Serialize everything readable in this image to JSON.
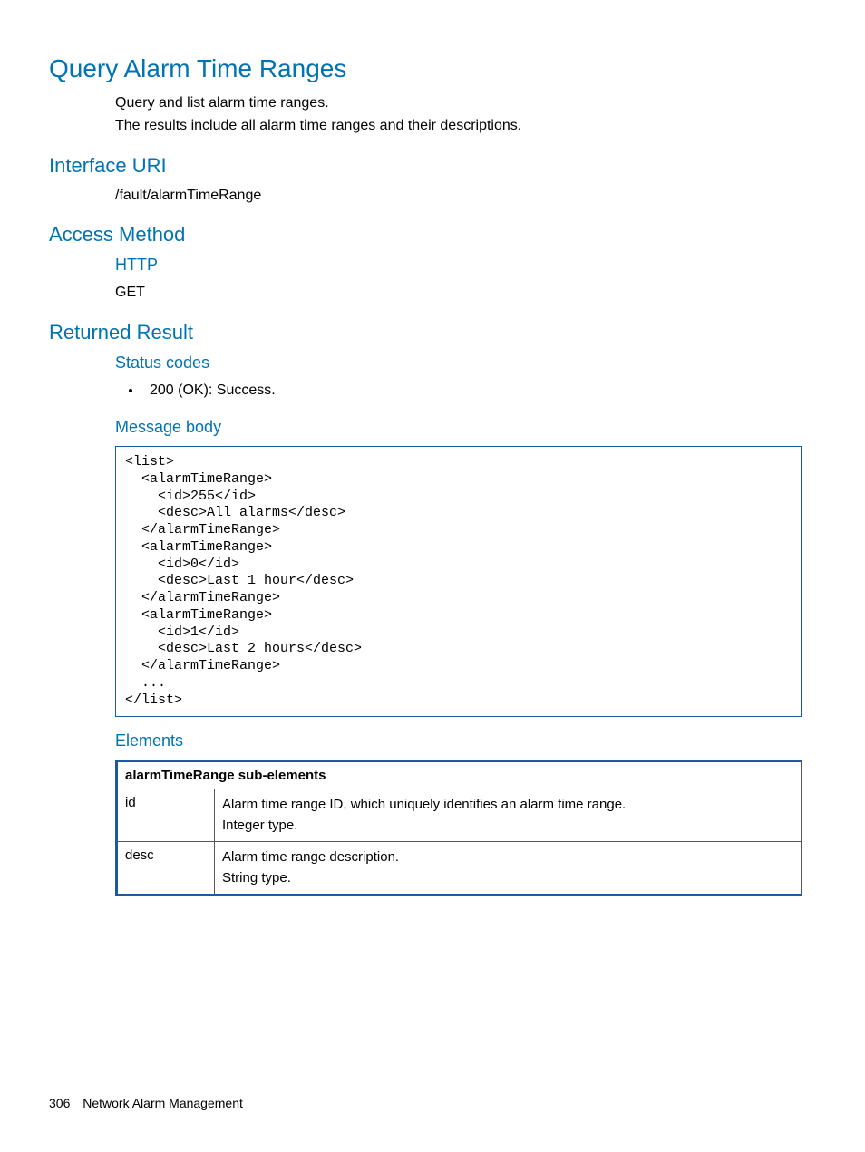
{
  "page": {
    "title": "Query Alarm Time Ranges",
    "intro1": "Query and list alarm time ranges.",
    "intro2": "The results include all alarm time ranges and their descriptions."
  },
  "interface_uri": {
    "heading": "Interface URI",
    "value": "/fault/alarmTimeRange"
  },
  "access_method": {
    "heading": "Access Method",
    "http_label": "HTTP",
    "http_method": "GET"
  },
  "returned_result": {
    "heading": "Returned Result",
    "status_codes_heading": "Status codes",
    "status_code_item": "200 (OK): Success.",
    "message_body_heading": "Message body",
    "code": "<list>\n  <alarmTimeRange>\n    <id>255</id>\n    <desc>All alarms</desc>\n  </alarmTimeRange>\n  <alarmTimeRange>\n    <id>0</id>\n    <desc>Last 1 hour</desc>\n  </alarmTimeRange>\n  <alarmTimeRange>\n    <id>1</id>\n    <desc>Last 2 hours</desc>\n  </alarmTimeRange>\n  ...\n</list>",
    "elements_heading": "Elements",
    "table": {
      "header": "alarmTimeRange sub-elements",
      "rows": [
        {
          "name": "id",
          "desc_line1": "Alarm time range ID, which uniquely identifies an alarm time range.",
          "desc_line2": "Integer type."
        },
        {
          "name": "desc",
          "desc_line1": "Alarm time range description.",
          "desc_line2": "String type."
        }
      ]
    }
  },
  "footer": {
    "page_number": "306",
    "section": "Network Alarm Management"
  }
}
